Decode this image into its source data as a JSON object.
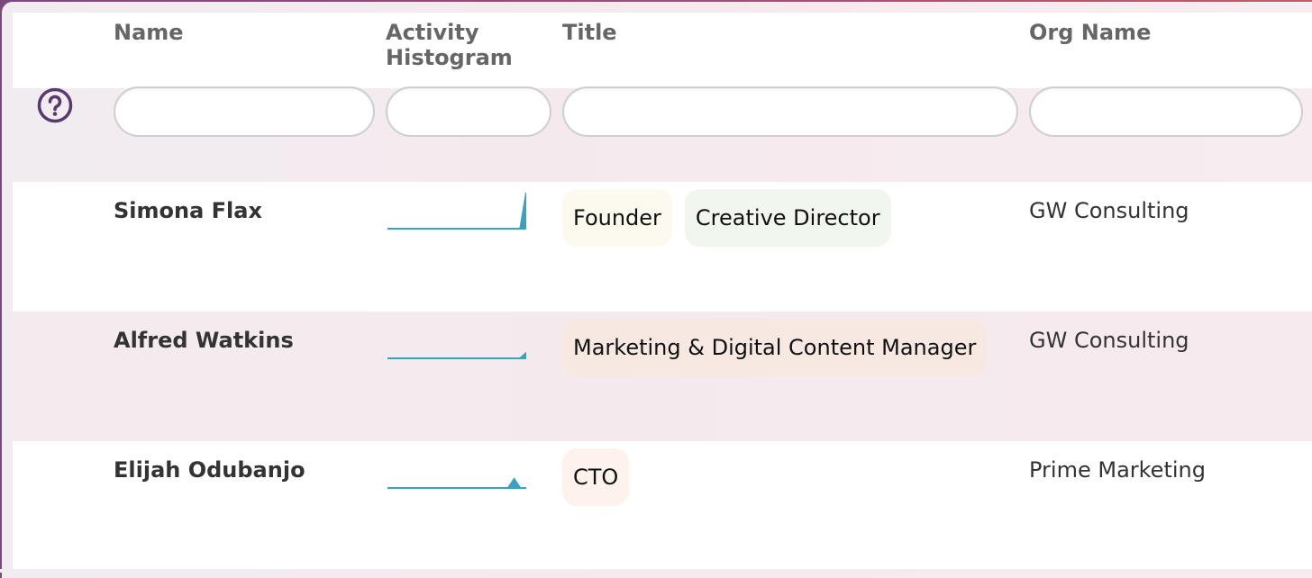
{
  "columns": {
    "name": "Name",
    "activity_line1": "Activity",
    "activity_line2": "Histogram",
    "title": "Title",
    "org": "Org Name"
  },
  "filters": {
    "name": "",
    "activity": "",
    "title": "",
    "org": ""
  },
  "help_icon": "question-circle-icon",
  "colors": {
    "accent": "#5a3a6e",
    "histogram": "#38a3bf",
    "header_text": "#666666"
  },
  "rows": [
    {
      "name": "Simona Flax",
      "org": "GW Consulting",
      "histogram": [
        0,
        0,
        0,
        0,
        0,
        0,
        0,
        0,
        0,
        0,
        0,
        0,
        0,
        0,
        0,
        0,
        0,
        0,
        0,
        0,
        0,
        0,
        0,
        1
      ],
      "tags": [
        {
          "label": "Founder",
          "color": "#fcf9ef"
        },
        {
          "label": "Creative Director",
          "color": "#f1f7ee"
        }
      ]
    },
    {
      "name": "Alfred Watkins",
      "org": "GW Consulting",
      "histogram": [
        0,
        0,
        0,
        0,
        0,
        0,
        0,
        0,
        0,
        0,
        0,
        0,
        0,
        0,
        0,
        0,
        0,
        0,
        0,
        0,
        0,
        0,
        0,
        0.15
      ],
      "tags": [
        {
          "label": "Marketing & Digital Content Manager",
          "color": "#f7e8e2"
        }
      ]
    },
    {
      "name": "Elijah Odubanjo",
      "org": "Prime Marketing",
      "histogram": [
        0,
        0,
        0,
        0,
        0,
        0,
        0,
        0,
        0,
        0,
        0,
        0,
        0,
        0,
        0,
        0,
        0,
        0,
        0,
        0,
        0,
        0.25,
        0,
        0
      ],
      "tags": [
        {
          "label": "CTO",
          "color": "#fdf3ec"
        }
      ]
    }
  ]
}
